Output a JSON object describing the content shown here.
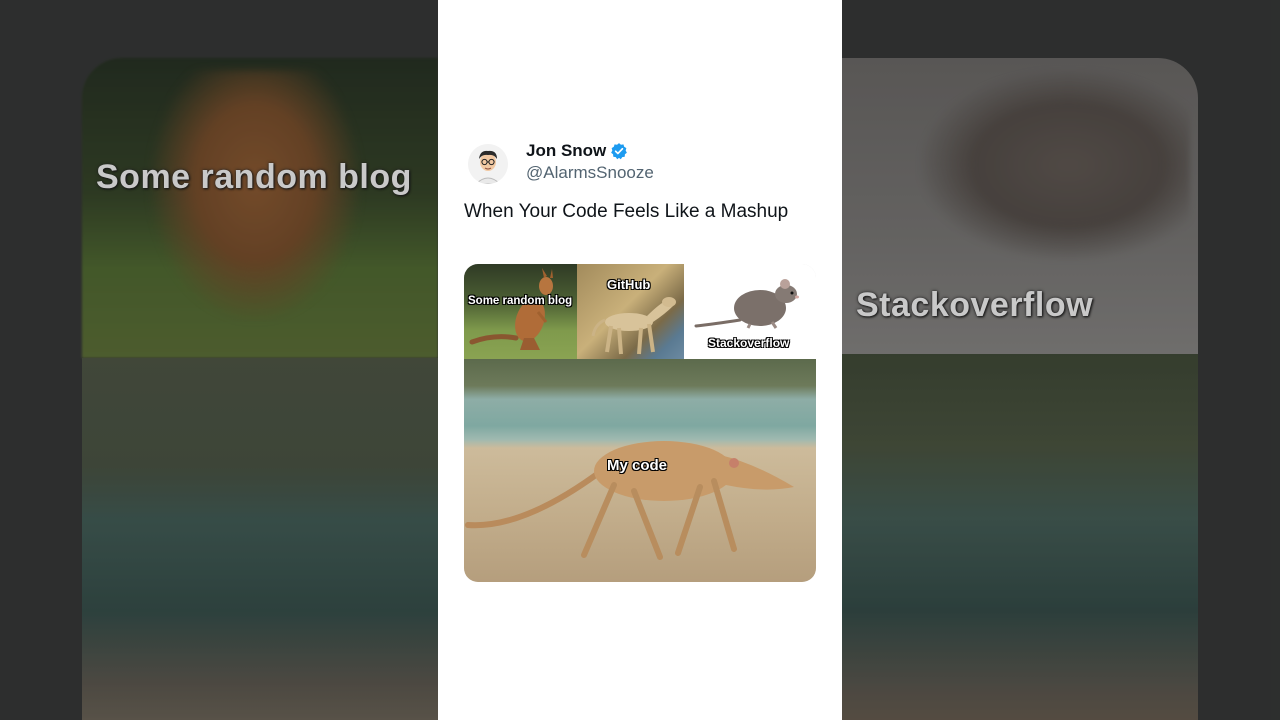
{
  "backdrop": {
    "left_label": "Some random blog",
    "right_label": "Stackoverflow"
  },
  "tweet": {
    "author": {
      "name": "Jon Snow",
      "handle": "@AlarmsSnooze",
      "verified": true,
      "avatar_icon": "avatar-cartoon-icon"
    },
    "text": "When Your Code Feels Like a Mashup",
    "media": {
      "panels": [
        {
          "label": "Some random blog",
          "subject": "kangaroo"
        },
        {
          "label": "GitHub",
          "subject": "dog"
        },
        {
          "label": "Stackoverflow",
          "subject": "rat"
        },
        {
          "label": "My code",
          "subject": "mashup-animal"
        }
      ]
    }
  },
  "colors": {
    "verified_badge": "#1d9bf0",
    "handle": "#536471",
    "text": "#0f1419",
    "card_bg": "#ffffff"
  }
}
